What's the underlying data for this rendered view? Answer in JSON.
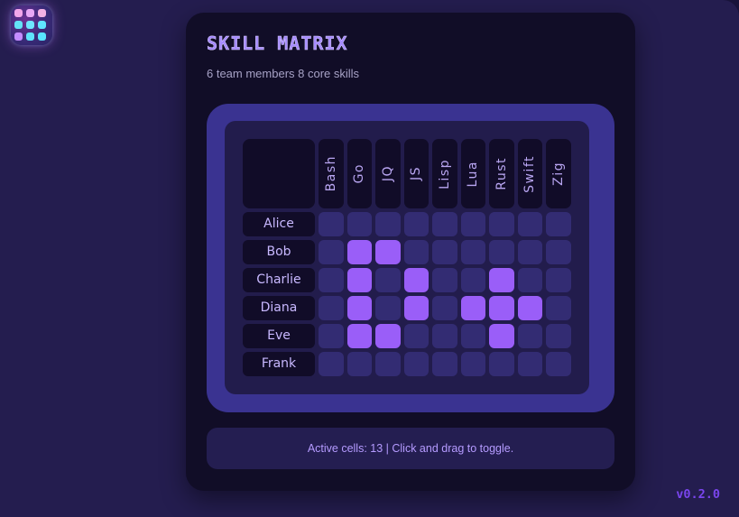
{
  "app_icon": "grid-app-icon",
  "header": {
    "title": "SKILL MATRIX",
    "subtitle": "6 team members 8 core skills"
  },
  "matrix": {
    "skills": [
      "Bash",
      "Go",
      "JQ",
      "JS",
      "Lisp",
      "Lua",
      "Rust",
      "Swift",
      "Zig"
    ],
    "members": [
      {
        "name": "Alice",
        "active": [
          false,
          false,
          false,
          false,
          false,
          false,
          false,
          false,
          false
        ]
      },
      {
        "name": "Bob",
        "active": [
          false,
          true,
          true,
          false,
          false,
          false,
          false,
          false,
          false
        ]
      },
      {
        "name": "Charlie",
        "active": [
          false,
          true,
          false,
          true,
          false,
          false,
          true,
          false,
          false
        ]
      },
      {
        "name": "Diana",
        "active": [
          false,
          true,
          false,
          true,
          false,
          true,
          true,
          true,
          false
        ]
      },
      {
        "name": "Eve",
        "active": [
          false,
          true,
          true,
          false,
          false,
          false,
          true,
          false,
          false
        ]
      },
      {
        "name": "Frank",
        "active": [
          false,
          false,
          false,
          false,
          false,
          false,
          false,
          false,
          false
        ]
      }
    ]
  },
  "status": {
    "text": "Active cells: 13 | Click and drag to toggle."
  },
  "version": "v0.2.0",
  "colors": {
    "background": "#241d4f",
    "card": "#110d27",
    "frame": "#3a3391",
    "cell_inactive": "#332c73",
    "accent": "#9a5ef8"
  }
}
